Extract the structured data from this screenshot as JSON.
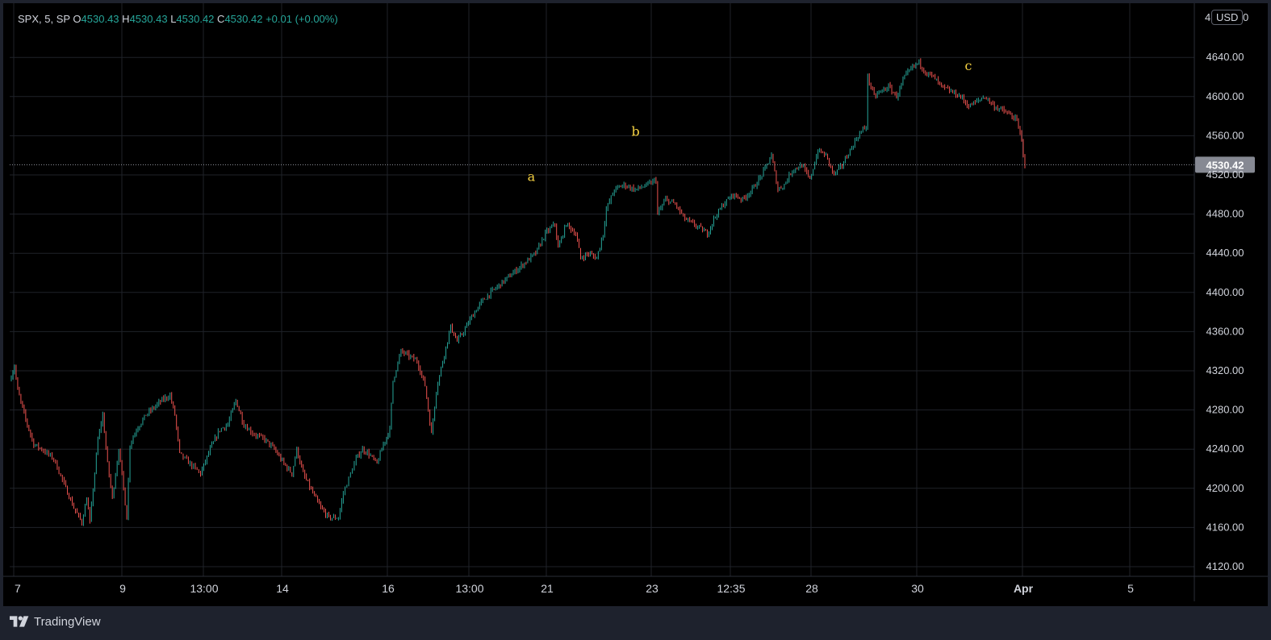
{
  "legend": {
    "symbol": "SPX, 5, SP",
    "open_label": "O",
    "open": "4530.43",
    "high_label": "H",
    "high": "4530.43",
    "low_label": "L",
    "low": "4530.42",
    "close_label": "C",
    "close": "4530.42",
    "change": "+0.01 (+0.00%)"
  },
  "currency": "USD",
  "footer": {
    "brand": "TradingView",
    "logo_icon": "tradingview-logo-icon"
  },
  "colors": {
    "up": "#26a69a",
    "down": "#ef5350",
    "grid": "#1f2229",
    "axis_text": "#d1d4dc",
    "annotation": "#f5d142",
    "price_tag_bg": "#868993",
    "background": "#000000",
    "frame": "#1e222d"
  },
  "chart_data": {
    "type": "candlestick",
    "symbol": "SPX",
    "interval": "5",
    "yticks": [
      4120,
      4160,
      4200,
      4240,
      4280,
      4320,
      4360,
      4400,
      4440,
      4480,
      4520,
      4560,
      4600,
      4640
    ],
    "ytick_labels": [
      "4120.00",
      "4160.00",
      "4200.00",
      "4240.00",
      "4280.00",
      "4320.00",
      "4360.00",
      "4400.00",
      "4440.00",
      "4480.00",
      "4520.00",
      "4560.00",
      "4600.00",
      "4640.00"
    ],
    "top_partial_label": "4",
    "top_partial_label_end": "0",
    "ylim": [
      4100,
      4685
    ],
    "xticks": [
      "7",
      "9",
      "13:00",
      "14",
      "16",
      "13:00",
      "21",
      "23",
      "12:35",
      "28",
      "30",
      "Apr",
      "5"
    ],
    "last_price": 4530.42,
    "last_price_label": "4530.42",
    "annotations": [
      {
        "text": "a",
        "x_bar": 1301,
        "price": 4514
      },
      {
        "text": "b",
        "x_bar": 1561,
        "price": 4560
      },
      {
        "text": "c",
        "x_bar": 2391,
        "price": 4627
      }
    ],
    "series_path": [
      [
        0,
        4310
      ],
      [
        6,
        4325
      ],
      [
        10,
        4300
      ],
      [
        20,
        4270
      ],
      [
        30,
        4245
      ],
      [
        40,
        4240
      ],
      [
        55,
        4230
      ],
      [
        70,
        4200
      ],
      [
        80,
        4180
      ],
      [
        90,
        4165
      ],
      [
        96,
        4190
      ],
      [
        100,
        4165
      ],
      [
        110,
        4250
      ],
      [
        116,
        4275
      ],
      [
        122,
        4225
      ],
      [
        128,
        4190
      ],
      [
        136,
        4240
      ],
      [
        142,
        4200
      ],
      [
        146,
        4170
      ],
      [
        150,
        4245
      ],
      [
        158,
        4260
      ],
      [
        170,
        4275
      ],
      [
        190,
        4290
      ],
      [
        200,
        4295
      ],
      [
        206,
        4275
      ],
      [
        212,
        4235
      ],
      [
        225,
        4225
      ],
      [
        238,
        4215
      ],
      [
        250,
        4240
      ],
      [
        262,
        4260
      ],
      [
        272,
        4265
      ],
      [
        282,
        4290
      ],
      [
        292,
        4265
      ],
      [
        305,
        4255
      ],
      [
        318,
        4250
      ],
      [
        330,
        4240
      ],
      [
        342,
        4225
      ],
      [
        352,
        4215
      ],
      [
        358,
        4240
      ],
      [
        366,
        4215
      ],
      [
        378,
        4195
      ],
      [
        388,
        4180
      ],
      [
        398,
        4170
      ],
      [
        410,
        4170
      ],
      [
        416,
        4195
      ],
      [
        425,
        4215
      ],
      [
        432,
        4230
      ],
      [
        440,
        4240
      ],
      [
        448,
        4235
      ],
      [
        458,
        4225
      ],
      [
        466,
        4245
      ],
      [
        474,
        4260
      ],
      [
        478,
        4310
      ],
      [
        488,
        4340
      ],
      [
        498,
        4335
      ],
      [
        508,
        4330
      ],
      [
        518,
        4305
      ],
      [
        526,
        4255
      ],
      [
        532,
        4300
      ],
      [
        540,
        4330
      ],
      [
        550,
        4365
      ],
      [
        558,
        4350
      ],
      [
        566,
        4360
      ],
      [
        576,
        4375
      ],
      [
        588,
        4390
      ],
      [
        600,
        4400
      ],
      [
        614,
        4410
      ],
      [
        628,
        4420
      ],
      [
        642,
        4430
      ],
      [
        656,
        4440
      ],
      [
        668,
        4460
      ],
      [
        680,
        4470
      ],
      [
        684,
        4445
      ],
      [
        694,
        4470
      ],
      [
        706,
        4460
      ],
      [
        712,
        4435
      ],
      [
        722,
        4440
      ],
      [
        732,
        4435
      ],
      [
        740,
        4460
      ],
      [
        744,
        4485
      ],
      [
        754,
        4505
      ],
      [
        766,
        4510
      ],
      [
        780,
        4505
      ],
      [
        796,
        4510
      ],
      [
        806,
        4515
      ],
      [
        808,
        4480
      ],
      [
        818,
        4495
      ],
      [
        830,
        4490
      ],
      [
        842,
        4475
      ],
      [
        852,
        4470
      ],
      [
        862,
        4465
      ],
      [
        870,
        4460
      ],
      [
        878,
        4475
      ],
      [
        890,
        4490
      ],
      [
        902,
        4500
      ],
      [
        914,
        4495
      ],
      [
        926,
        4505
      ],
      [
        938,
        4520
      ],
      [
        950,
        4540
      ],
      [
        958,
        4505
      ],
      [
        966,
        4510
      ],
      [
        976,
        4525
      ],
      [
        988,
        4530
      ],
      [
        998,
        4515
      ],
      [
        1008,
        4545
      ],
      [
        1018,
        4540
      ],
      [
        1028,
        4520
      ],
      [
        1038,
        4530
      ],
      [
        1048,
        4545
      ],
      [
        1058,
        4560
      ],
      [
        1068,
        4570
      ],
      [
        1070,
        4620
      ],
      [
        1078,
        4600
      ],
      [
        1086,
        4605
      ],
      [
        1096,
        4610
      ],
      [
        1106,
        4600
      ],
      [
        1116,
        4620
      ],
      [
        1126,
        4630
      ],
      [
        1134,
        4635
      ],
      [
        1142,
        4625
      ],
      [
        1152,
        4620
      ],
      [
        1162,
        4610
      ],
      [
        1174,
        4605
      ],
      [
        1186,
        4600
      ],
      [
        1196,
        4590
      ],
      [
        1206,
        4595
      ],
      [
        1216,
        4600
      ],
      [
        1228,
        4590
      ],
      [
        1240,
        4585
      ],
      [
        1250,
        4580
      ],
      [
        1256,
        4575
      ],
      [
        1262,
        4555
      ],
      [
        1266,
        4530.42
      ]
    ]
  }
}
